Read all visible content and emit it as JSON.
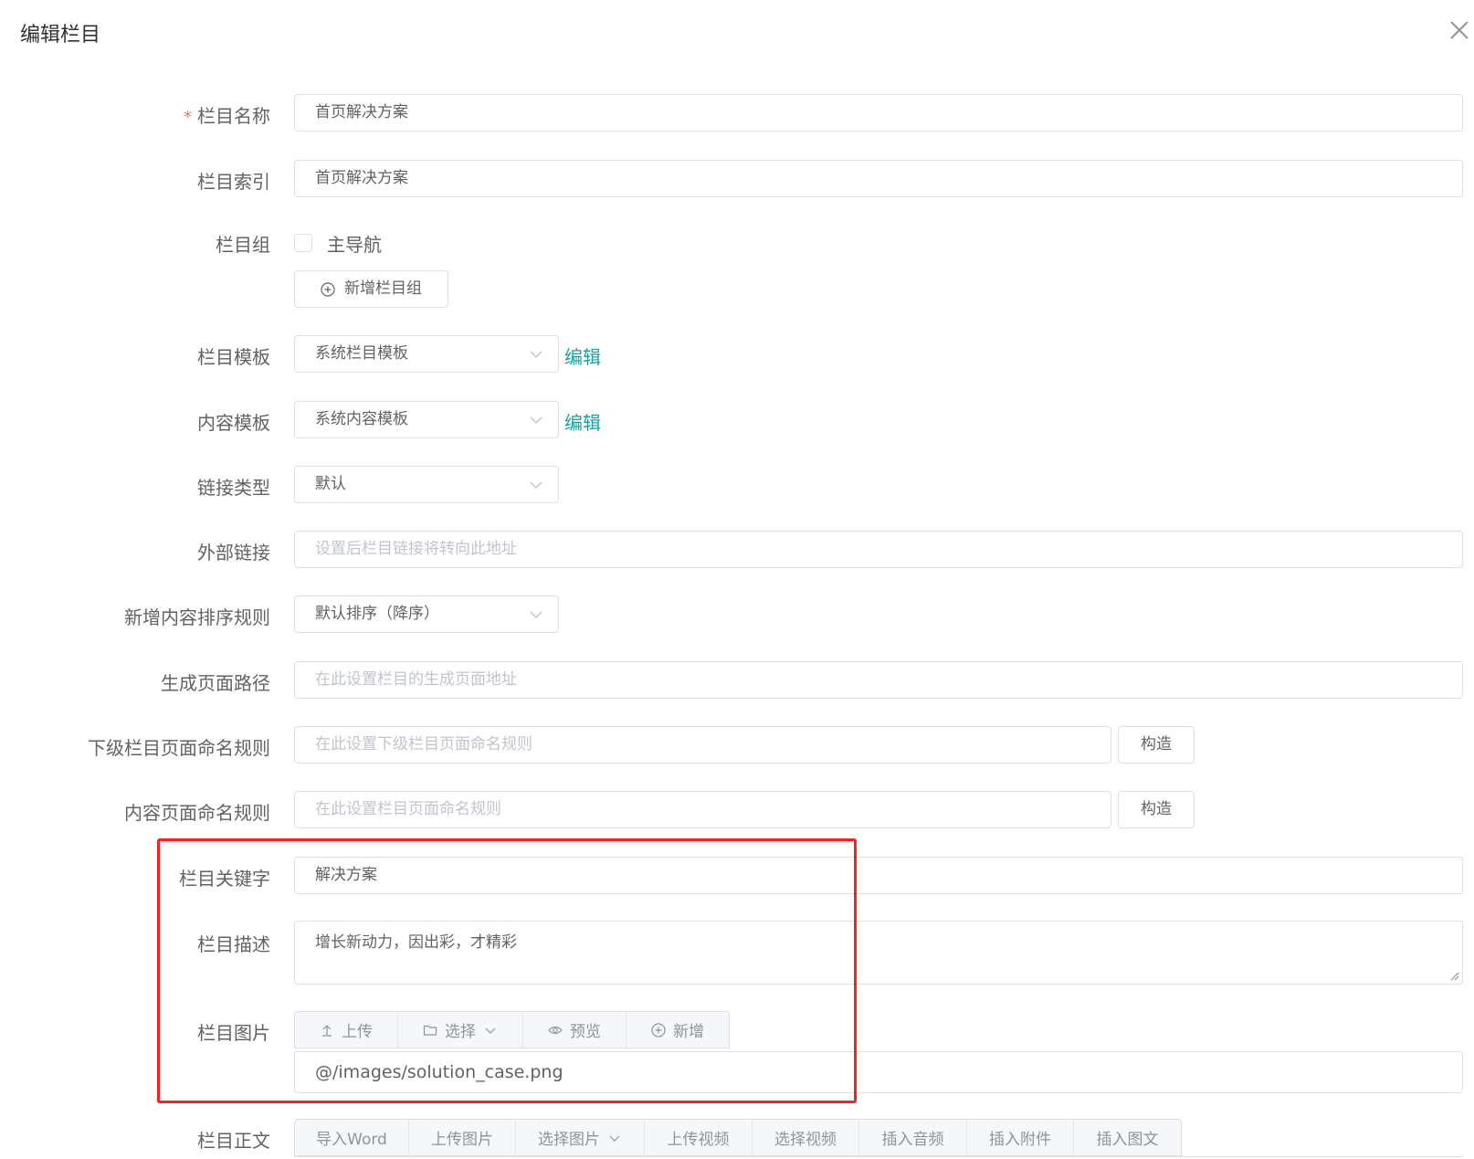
{
  "dialog": {
    "title": "编辑栏目"
  },
  "fields": {
    "name": {
      "label": "栏目名称",
      "required_mark": "*",
      "value": "首页解决方案"
    },
    "index": {
      "label": "栏目索引",
      "value": "首页解决方案"
    },
    "group": {
      "label": "栏目组",
      "checkbox_label": "主导航",
      "checked": false,
      "add_button": "新增栏目组"
    },
    "channel_template": {
      "label": "栏目模板",
      "value": "系统栏目模板",
      "edit_link": "编辑"
    },
    "content_template": {
      "label": "内容模板",
      "value": "系统内容模板",
      "edit_link": "编辑"
    },
    "link_type": {
      "label": "链接类型",
      "value": "默认"
    },
    "external_link": {
      "label": "外部链接",
      "placeholder": "设置后栏目链接将转向此地址"
    },
    "sort_rule": {
      "label": "新增内容排序规则",
      "value": "默认排序（降序）"
    },
    "page_path": {
      "label": "生成页面路径",
      "placeholder": "在此设置栏目的生成页面地址"
    },
    "child_naming": {
      "label": "下级栏目页面命名规则",
      "placeholder": "在此设置下级栏目页面命名规则",
      "button": "构造"
    },
    "content_naming": {
      "label": "内容页面命名规则",
      "placeholder": "在此设置栏目页面命名规则",
      "button": "构造"
    },
    "keywords": {
      "label": "栏目关键字",
      "value": "解决方案"
    },
    "description": {
      "label": "栏目描述",
      "value": "增长新动力，因出彩，才精彩"
    },
    "image": {
      "label": "栏目图片",
      "buttons": {
        "upload": "上传",
        "select": "选择",
        "preview": "预览",
        "add": "新增"
      },
      "value": "@/images/solution_case.png"
    },
    "body": {
      "label": "栏目正文",
      "toolbar": [
        "导入Word",
        "上传图片",
        "选择图片",
        "上传视频",
        "选择视频",
        "插入音频",
        "插入附件",
        "插入图文"
      ]
    }
  },
  "colors": {
    "accent": "#17a2a2",
    "required": "#f56c6c",
    "highlight_border": "#ff1d1d"
  }
}
